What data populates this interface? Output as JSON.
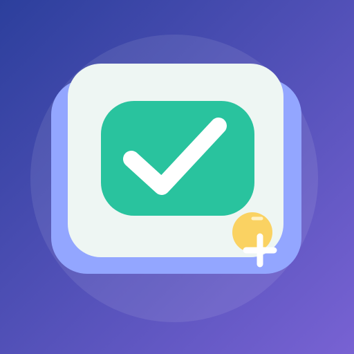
{
  "icon": {
    "name": "checkbox-add-app-icon",
    "symbols": [
      "checkmark",
      "plus"
    ],
    "colors": {
      "background_start": "#2C3F9C",
      "background_end": "#7862D3",
      "halo": "#FFFFFF",
      "card_back": "#93A6FF",
      "card_front": "#EEF6F3",
      "check_box": "#29C39E",
      "checkmark": "#FFFFFF",
      "badge": "#FAD262",
      "badge_highlight": "#FFF1C4",
      "plus": "#FFFFFF"
    }
  }
}
